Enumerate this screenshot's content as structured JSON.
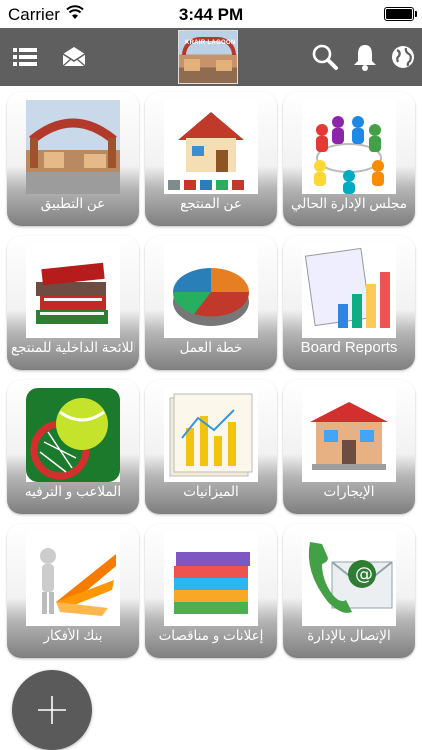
{
  "status_bar": {
    "carrier": "Carrier",
    "time": "3:44 PM"
  },
  "nav_bar": {
    "logo_text": "KRAIR LAGOON",
    "icons": [
      "list-icon",
      "envelope-icon",
      "search-icon",
      "bell-icon",
      "globe-icon"
    ]
  },
  "tiles": [
    {
      "label": "مجلس الإدارة الحالي",
      "icon": "meeting-icon"
    },
    {
      "label": "عن المنتجع",
      "icon": "house-icon"
    },
    {
      "label": "عن التطبيق",
      "icon": "resort-photo-icon"
    },
    {
      "label": "Board Reports",
      "icon": "bar-chart-icon"
    },
    {
      "label": "خطة العمل",
      "icon": "pie-chart-icon"
    },
    {
      "label": "اللائحة الداخلية للمنتجع",
      "icon": "books-icon"
    },
    {
      "label": "الإيجارات",
      "icon": "shop-icon"
    },
    {
      "label": "الميزانيات",
      "icon": "budget-chart-icon"
    },
    {
      "label": "الملاعب و الترفيه",
      "icon": "tennis-icon"
    },
    {
      "label": "الإتصال بالإدارة",
      "icon": "phone-email-icon"
    },
    {
      "label": "إعلانات و مناقصات",
      "icon": "folders-icon"
    },
    {
      "label": "بنك الأفكار",
      "icon": "ideas-icon"
    }
  ],
  "colors": {
    "nav_bg": "#5f5f5f",
    "tile_gradient_bottom": "#7f7f7f",
    "fab_bg": "#5a5a5a"
  }
}
